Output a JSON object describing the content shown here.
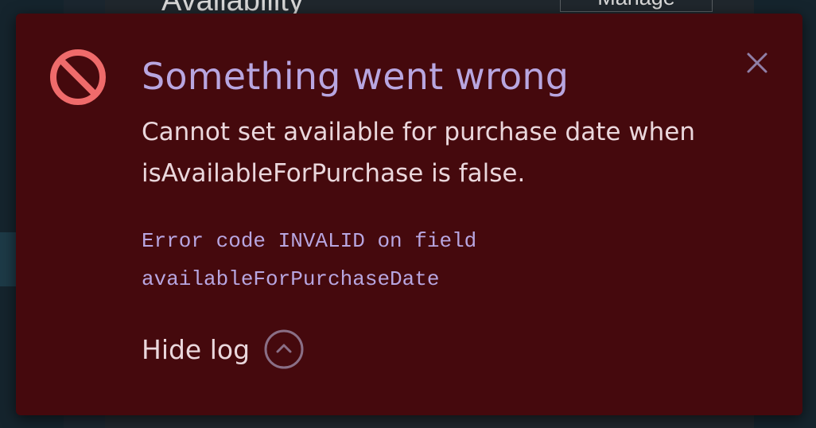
{
  "background": {
    "heading": "Availability",
    "manage_button": "Manage"
  },
  "toast": {
    "title": "Something went wrong",
    "message": "Cannot set available for purchase date when isAvailableForPurchase is false.",
    "log_lines": [
      "Error code INVALID on field",
      "availableForPurchaseDate"
    ],
    "hide_log_label": "Hide log",
    "icons": {
      "status": "prohibited-icon",
      "close": "close-icon",
      "toggle": "chevron-up-icon"
    },
    "colors": {
      "background": "#45090d",
      "title": "#b8a6e0",
      "icon": "#ef6b6b"
    }
  }
}
